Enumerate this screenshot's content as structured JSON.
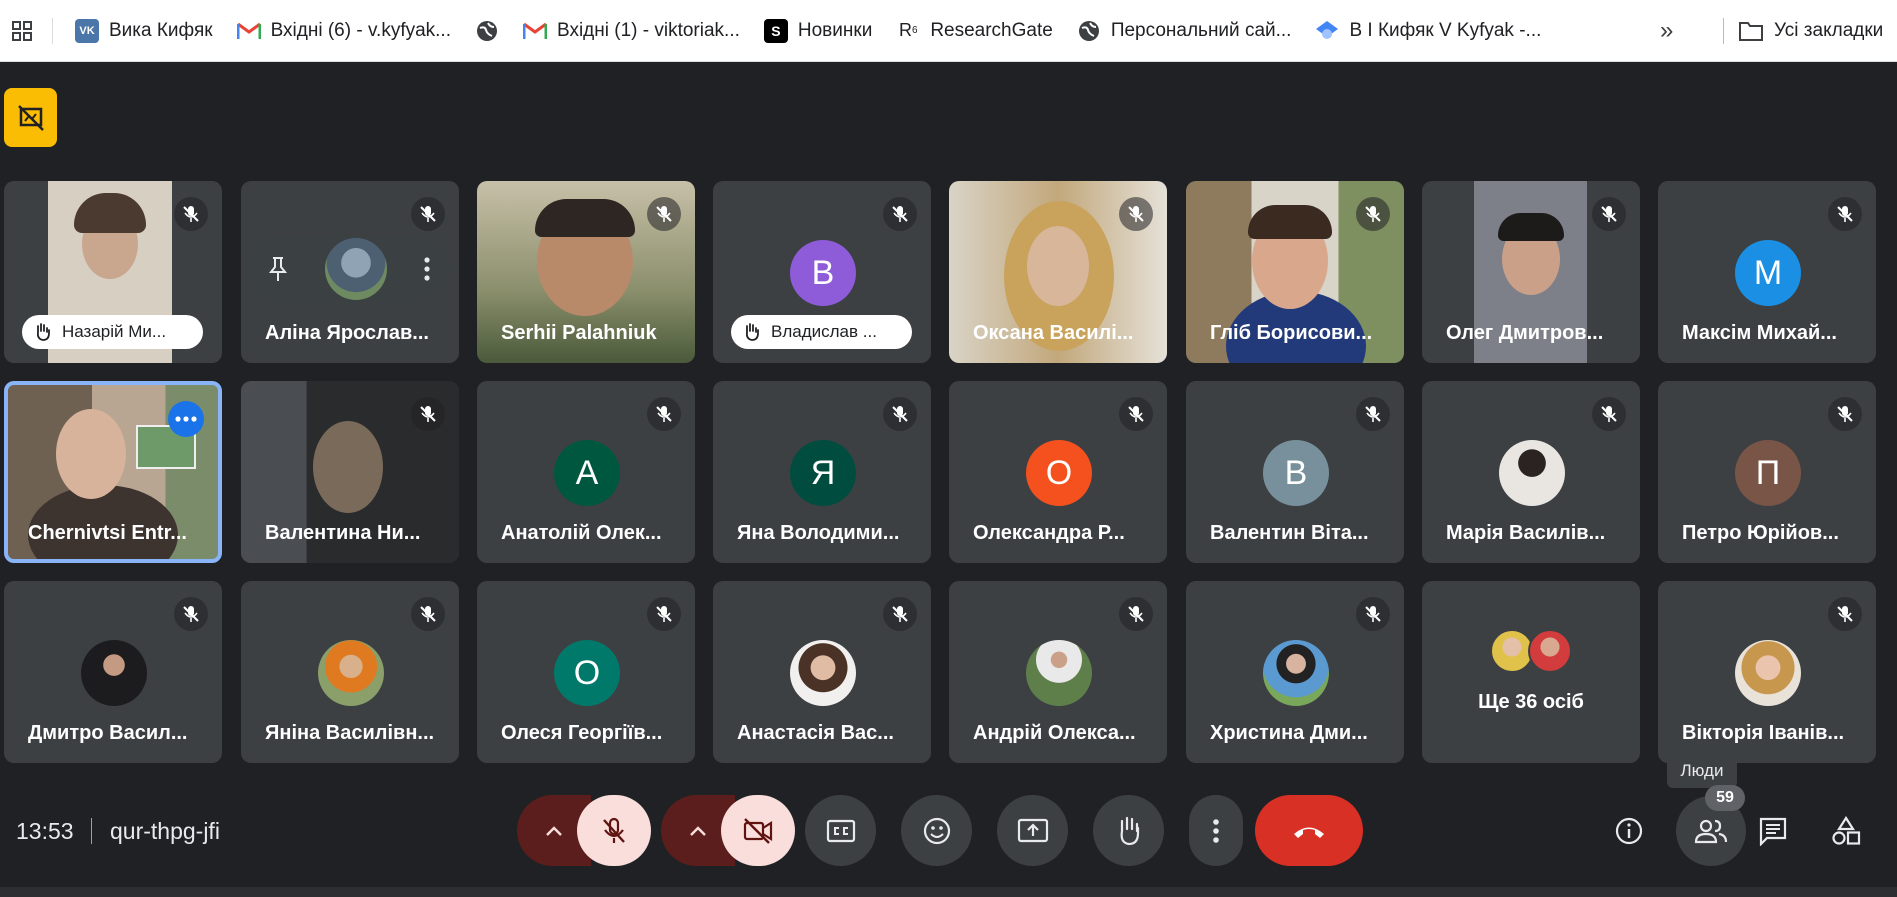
{
  "bookmarks": {
    "items": [
      {
        "label": "Вика Кифяк",
        "icon": "vk-icon",
        "color": "#4a76a8",
        "glyph": "VK"
      },
      {
        "label": "Вхідні (6) - v.kyfyak...",
        "icon": "gmail-icon",
        "color": "#ea4335",
        "glyph": "M"
      },
      {
        "label": "",
        "icon": "globe-icon",
        "color": "#3c4043",
        "glyph": ""
      },
      {
        "label": "Вхідні (1) - viktoriak...",
        "icon": "gmail-icon",
        "color": "#ea4335",
        "glyph": "M"
      },
      {
        "label": "Новинки",
        "icon": "s-icon",
        "color": "#000000",
        "glyph": "S"
      },
      {
        "label": "ResearchGate",
        "icon": "researchgate-icon",
        "color": "#ffffff",
        "glyph": "R⁶"
      },
      {
        "label": "Персональний сай...",
        "icon": "globe-icon",
        "color": "#3c4043",
        "glyph": ""
      },
      {
        "label": "В І Кифяк V Kyfyak -...",
        "icon": "scholar-icon",
        "color": "#4285f4",
        "glyph": ""
      }
    ],
    "overflow": "»",
    "all_bookmarks": "Усі закладки"
  },
  "participants": [
    {
      "name": "Назарій Ми...",
      "hand_raised": true
    },
    {
      "name": "Аліна Ярослав...",
      "pinned_hover": true
    },
    {
      "name": "Serhii Palahniuk"
    },
    {
      "name": "Владислав ...",
      "hand_raised": true,
      "initial": "В",
      "avatar_color": "#8e5cd9"
    },
    {
      "name": "Оксана Василі..."
    },
    {
      "name": "Гліб Борисови..."
    },
    {
      "name": "Олег Дмитров..."
    },
    {
      "name": "Максім Михай...",
      "initial": "М",
      "avatar_color": "#1a8fe3"
    },
    {
      "name": "Chernivtsi Entr...",
      "active": true
    },
    {
      "name": "Валентина Ни..."
    },
    {
      "name": "Анатолій Олек...",
      "initial": "А",
      "avatar_color": "#00573f"
    },
    {
      "name": "Яна Володими...",
      "initial": "Я",
      "avatar_color": "#004d40"
    },
    {
      "name": "Олександра Р...",
      "initial": "О",
      "avatar_color": "#f4511e"
    },
    {
      "name": "Валентин Віта...",
      "initial": "В",
      "avatar_color": "#78909c"
    },
    {
      "name": "Марія Василів..."
    },
    {
      "name": "Петро Юрійов...",
      "initial": "П",
      "avatar_color": "#795548"
    },
    {
      "name": "Дмитро Васил..."
    },
    {
      "name": "Яніна Василівн..."
    },
    {
      "name": "Олеся Георгіїв...",
      "initial": "О",
      "avatar_color": "#00796b"
    },
    {
      "name": "Анастасія Вас..."
    },
    {
      "name": "Андрій Олекса..."
    },
    {
      "name": "Христина Дми..."
    },
    {
      "name": "Ще 36 осіб"
    },
    {
      "name": "Вікторія Іванів..."
    }
  ],
  "meeting": {
    "time": "13:53",
    "code": "qur-thpg-jfi"
  },
  "people": {
    "tooltip": "Люди",
    "count": "59"
  },
  "colors": {
    "background": "#202124",
    "tile": "#3c4043",
    "end_call": "#d93025",
    "present_accent": "#fbbc04",
    "active_border": "#8ab4f8"
  }
}
